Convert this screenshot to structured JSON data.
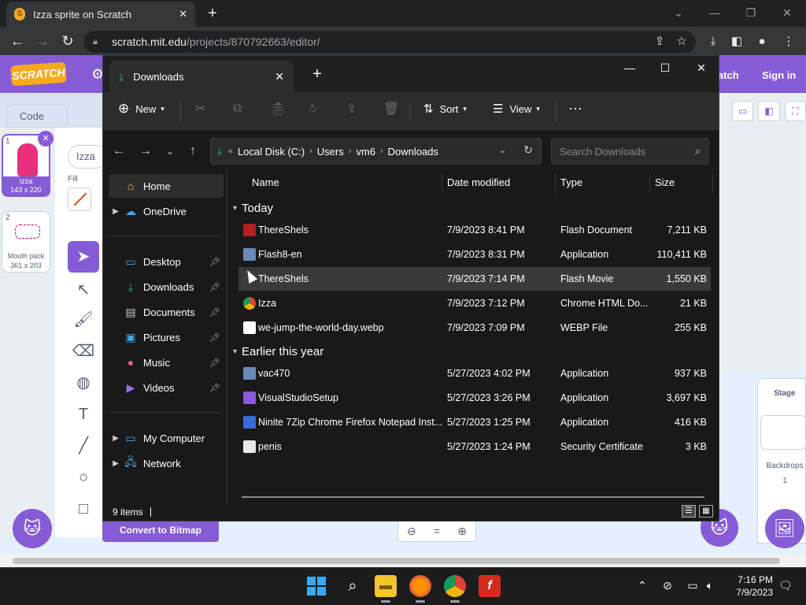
{
  "browser": {
    "tab_title": "Izza sprite on Scratch",
    "url_host": "scratch.mit.edu",
    "url_path": "/projects/870792663/editor/"
  },
  "scratch": {
    "logo": "SCRATCH",
    "tutorials_label": "atch",
    "signin_label": "Sign in",
    "code_tab": "Code",
    "costume_name": "Izza",
    "fill_label": "Fill",
    "sprites": [
      {
        "num": "1",
        "name": "Izza",
        "size": "143 x 220"
      },
      {
        "num": "2",
        "name": "Mouth pack",
        "size": "361 x 203"
      }
    ],
    "convert_button": "Convert to Bitmap",
    "stage_label": "Stage",
    "backdrops_label": "Backdrops",
    "backdrops_count": "1"
  },
  "explorer": {
    "tab_title": "Downloads",
    "commands": {
      "new": "New",
      "sort": "Sort",
      "view": "View"
    },
    "address": [
      "Local Disk (C:)",
      "Users",
      "vm6",
      "Downloads"
    ],
    "search_placeholder": "Search Downloads",
    "nav": {
      "home": "Home",
      "onedrive": "OneDrive",
      "desktop": "Desktop",
      "downloads": "Downloads",
      "documents": "Documents",
      "pictures": "Pictures",
      "music": "Music",
      "videos": "Videos",
      "mycomputer": "My Computer",
      "network": "Network"
    },
    "columns": {
      "name": "Name",
      "date": "Date modified",
      "type": "Type",
      "size": "Size"
    },
    "groups": {
      "today": "Today",
      "earlier": "Earlier this year"
    },
    "files": [
      {
        "name": "ThereShels",
        "date": "7/9/2023 8:41 PM",
        "type": "Flash Document",
        "size": "7,211 KB",
        "icon": "flash-document-icon"
      },
      {
        "name": "Flash8-en",
        "date": "7/9/2023 8:31 PM",
        "type": "Application",
        "size": "110,411 KB",
        "icon": "installer-icon"
      },
      {
        "name": "ThereShels",
        "date": "7/9/2023 7:14 PM",
        "type": "Flash Movie",
        "size": "1,550 KB",
        "icon": "flash-movie-icon"
      },
      {
        "name": "Izza",
        "date": "7/9/2023 7:12 PM",
        "type": "Chrome HTML Do...",
        "size": "21 KB",
        "icon": "chrome-html-icon"
      },
      {
        "name": "we-jump-the-world-day.webp",
        "date": "7/9/2023 7:09 PM",
        "type": "WEBP File",
        "size": "255 KB",
        "icon": "file-icon"
      },
      {
        "name": "vac470",
        "date": "5/27/2023 4:02 PM",
        "type": "Application",
        "size": "937 KB",
        "icon": "installer-icon"
      },
      {
        "name": "VisualStudioSetup",
        "date": "5/27/2023 3:26 PM",
        "type": "Application",
        "size": "3,697 KB",
        "icon": "visual-studio-icon"
      },
      {
        "name": "Ninite 7Zip Chrome Firefox Notepad Inst...",
        "date": "5/27/2023 1:25 PM",
        "type": "Application",
        "size": "416 KB",
        "icon": "ninite-icon"
      },
      {
        "name": "penis",
        "date": "5/27/2023 1:24 PM",
        "type": "Security Certificate",
        "size": "3 KB",
        "icon": "certificate-icon"
      }
    ],
    "status": "9 items"
  },
  "taskbar": {
    "time": "7:16 PM",
    "date": "7/9/2023"
  }
}
